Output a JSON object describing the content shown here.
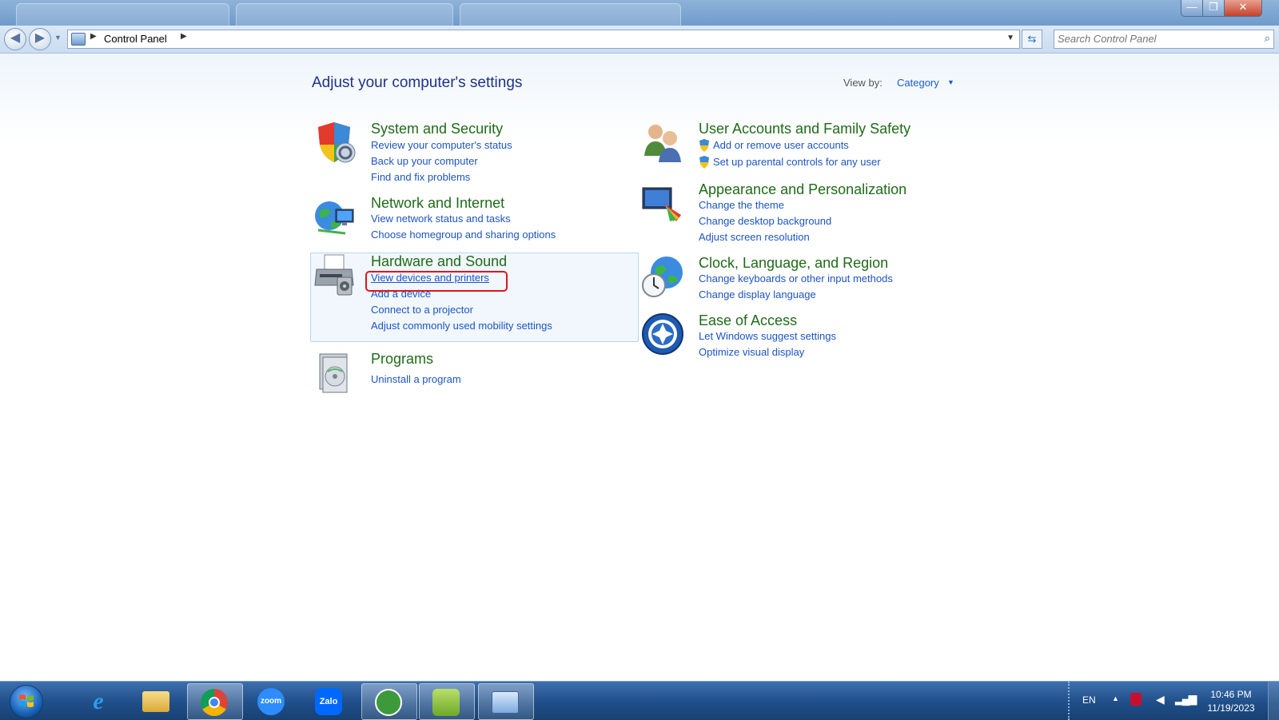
{
  "window": {
    "controls": {
      "minimize": "—",
      "restore": "❐",
      "close": "✕"
    }
  },
  "address": {
    "crumb": "Control Panel",
    "search_placeholder": "Search Control Panel"
  },
  "header": {
    "title": "Adjust your computer's settings",
    "view_by_label": "View by:",
    "view_by_value": "Category"
  },
  "left_categories": [
    {
      "title": "System and Security",
      "links": [
        "Review your computer's status",
        "Back up your computer",
        "Find and fix problems"
      ]
    },
    {
      "title": "Network and Internet",
      "links": [
        "View network status and tasks",
        "Choose homegroup and sharing options"
      ]
    },
    {
      "title": "Hardware and Sound",
      "links": [
        "View devices and printers",
        "Add a device",
        "Connect to a projector",
        "Adjust commonly used mobility settings"
      ]
    },
    {
      "title": "Programs",
      "links": [
        "Uninstall a program"
      ]
    }
  ],
  "right_categories": [
    {
      "title": "User Accounts and Family Safety",
      "links": [
        "Add or remove user accounts",
        "Set up parental controls for any user"
      ]
    },
    {
      "title": "Appearance and Personalization",
      "links": [
        "Change the theme",
        "Change desktop background",
        "Adjust screen resolution"
      ]
    },
    {
      "title": "Clock, Language, and Region",
      "links": [
        "Change keyboards or other input methods",
        "Change display language"
      ]
    },
    {
      "title": "Ease of Access",
      "links": [
        "Let Windows suggest settings",
        "Optimize visual display"
      ]
    }
  ],
  "taskbar": {
    "zoom_label": "zoom",
    "zalo_label": "Zalo",
    "language": "EN",
    "time": "10:46 PM",
    "date": "11/19/2023"
  },
  "colors": {
    "category_title": "#1f6b18",
    "link": "#1c54c2",
    "heading": "#1e3287",
    "highlight_border": "#e0131f"
  }
}
